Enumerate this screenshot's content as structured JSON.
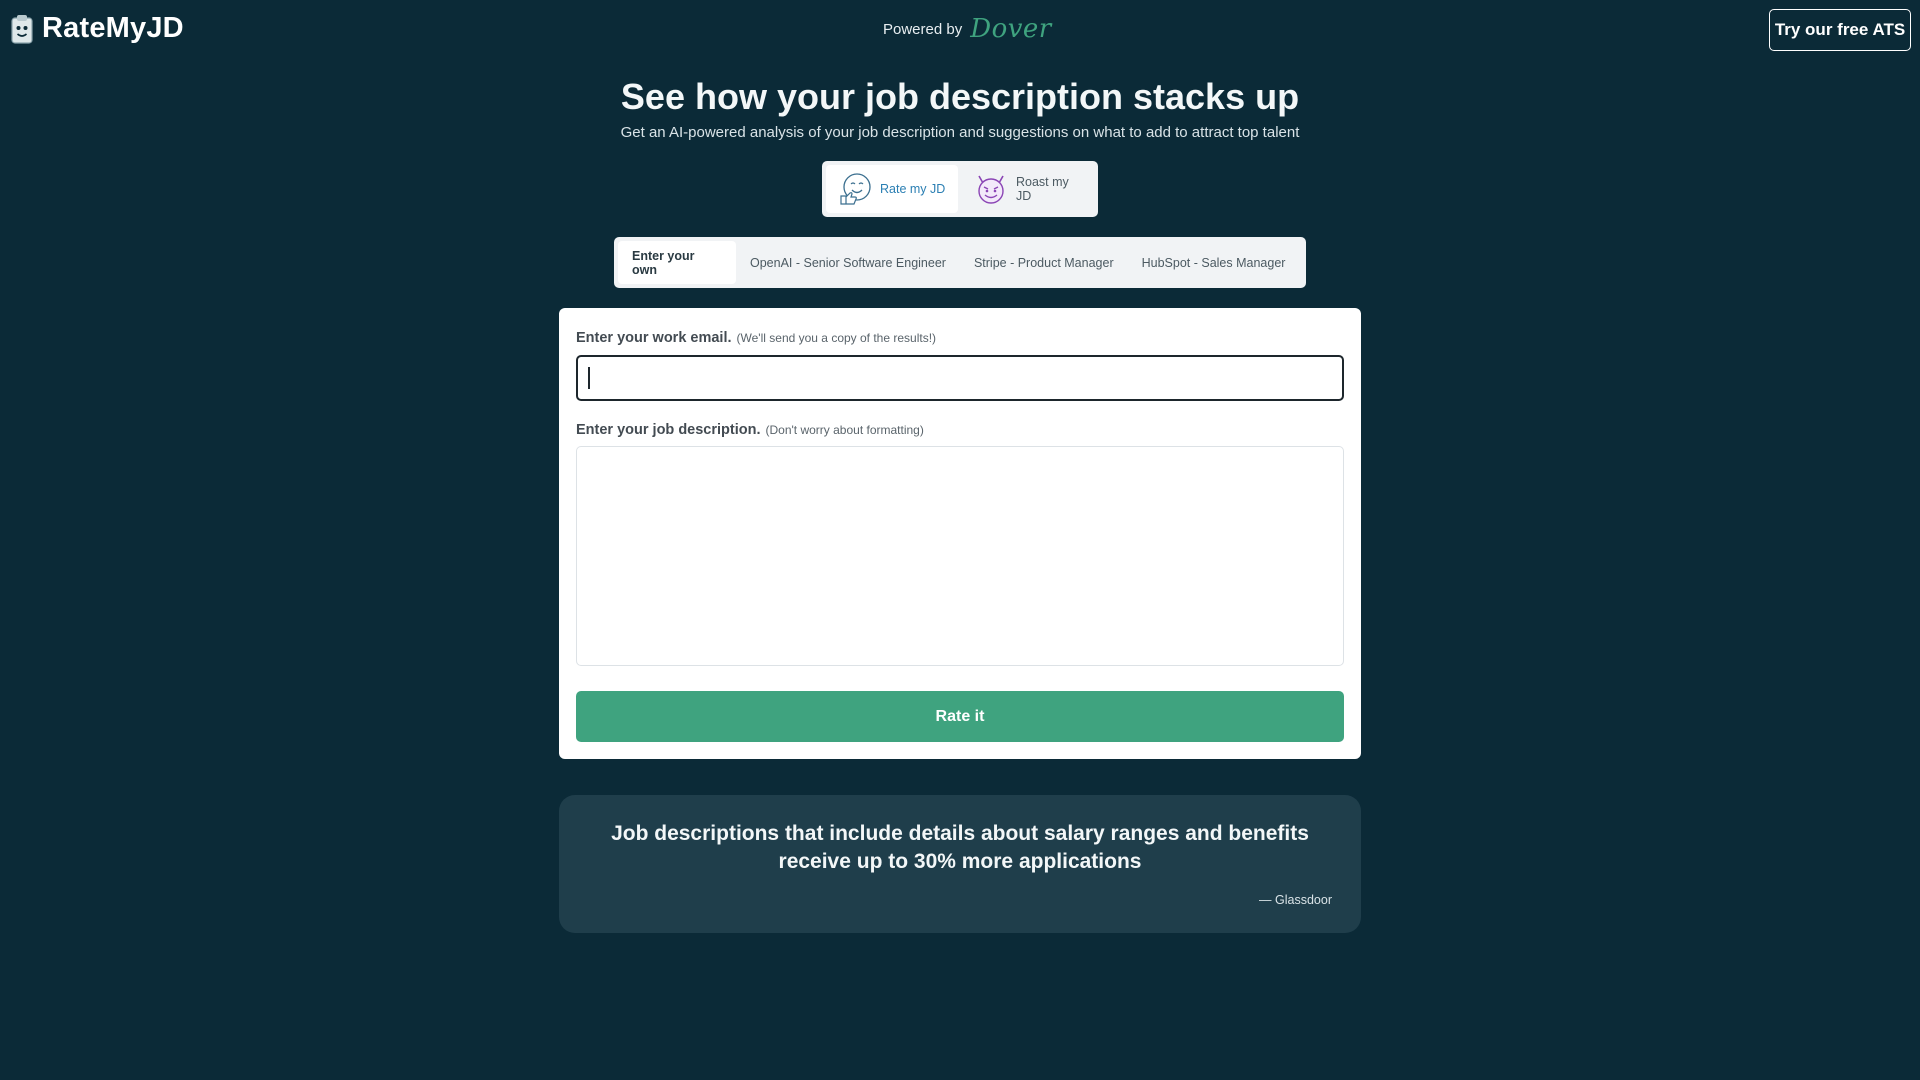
{
  "header": {
    "logo_text": "RateMyJD",
    "powered_label": "Powered by",
    "powered_brand": "Dover",
    "ats_button": "Try our free ATS"
  },
  "hero": {
    "title": "See how your job description stacks up",
    "subtitle": "Get an AI-powered analysis of your job description and suggestions on what to add to attract top talent"
  },
  "modes": [
    {
      "label": "Rate my JD",
      "icon": "thumbs-up-smiley-icon",
      "active": true
    },
    {
      "label": "Roast my JD",
      "icon": "devil-face-icon",
      "active": false
    }
  ],
  "example_tabs": [
    {
      "label": "Enter your own",
      "active": true
    },
    {
      "label": "OpenAI - Senior Software Engineer",
      "active": false
    },
    {
      "label": "Stripe - Product Manager",
      "active": false
    },
    {
      "label": "HubSpot - Sales Manager",
      "active": false
    }
  ],
  "form": {
    "email_label": "Enter your work email.",
    "email_hint": "(We'll send you a copy of the results!)",
    "email_value": "",
    "jd_label": "Enter your job description.",
    "jd_hint": "(Don't worry about formatting)",
    "jd_value": "",
    "submit_label": "Rate it"
  },
  "quote": {
    "text": "Job descriptions that include details about salary ranges and benefits receive up to 30% more applications",
    "source": "— Glassdoor"
  },
  "colors": {
    "background": "#0b2a37",
    "accent": "#3fa37f",
    "active_mode": "#2b7fb3",
    "quote_card": "#1f3e4b"
  }
}
